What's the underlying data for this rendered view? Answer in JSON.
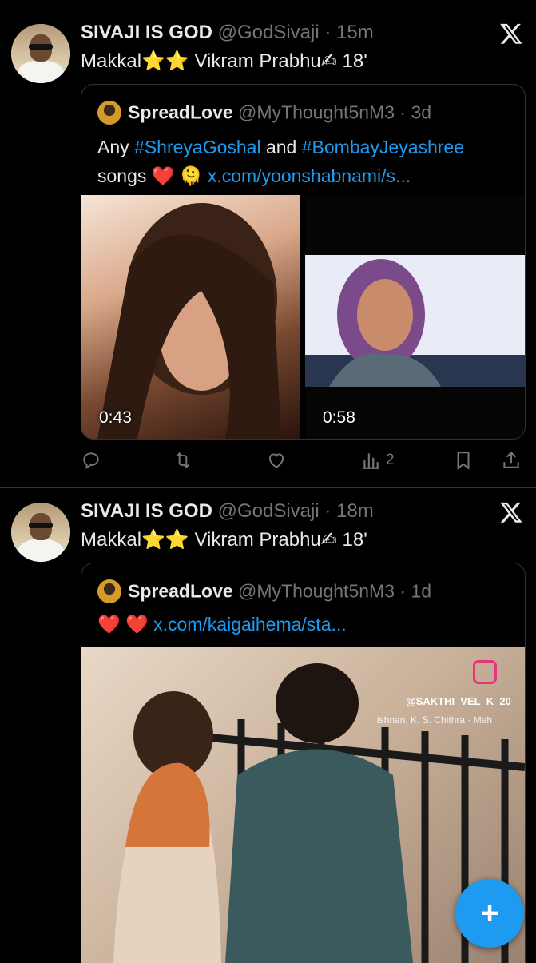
{
  "tweets": [
    {
      "author": "SIVAJI IS GOD",
      "handle": "@GodSivaji",
      "sep": " · ",
      "time": "15m",
      "text_before": "Makkal",
      "emoji_stars": "⭐⭐",
      "text_mid": " Vikram Prabhu",
      "emoji_hand": "✍",
      "text_after": " 18'",
      "quote": {
        "author": "SpreadLove",
        "handle": "@MyThought5nM3",
        "sep": " · ",
        "time": "3d",
        "line1_prefix": "Any ",
        "hashtag1": "#ShreyaGoshal",
        "line1_mid": " and ",
        "hashtag2": "#BombayJeyashree",
        "line2_prefix": "songs ",
        "line2_emoji": "❤️ 🫠 ",
        "link": "x.com/yoonshabnami/s...",
        "videos": [
          {
            "duration": "0:43"
          },
          {
            "duration": "0:58"
          }
        ]
      },
      "actions": {
        "reply": "reply-icon",
        "retweet": "retweet-icon",
        "like": "like-icon",
        "views": "views-icon",
        "views_count": "2",
        "bookmark": "bookmark-icon",
        "share": "share-icon"
      }
    },
    {
      "author": "SIVAJI IS GOD",
      "handle": "@GodSivaji",
      "sep": " · ",
      "time": "18m",
      "text_before": "Makkal",
      "emoji_stars": "⭐⭐",
      "text_mid": " Vikram Prabhu",
      "emoji_hand": "✍",
      "text_after": " 18'",
      "quote": {
        "author": "SpreadLove",
        "handle": "@MyThought5nM3",
        "sep": " · ",
        "time": "1d",
        "line1_emoji": "❤️ ❤️ ",
        "link": "x.com/kaigaihema/sta...",
        "video_watermark": "@SAKTHI_VEL_K_20",
        "video_caption": "ishnan, K. S. Chithra · Mah"
      }
    }
  ],
  "fab_label": "+",
  "colors": {
    "accent": "#1d9bf0",
    "muted": "#71767b",
    "border": "#2f3336",
    "background": "#000000"
  }
}
